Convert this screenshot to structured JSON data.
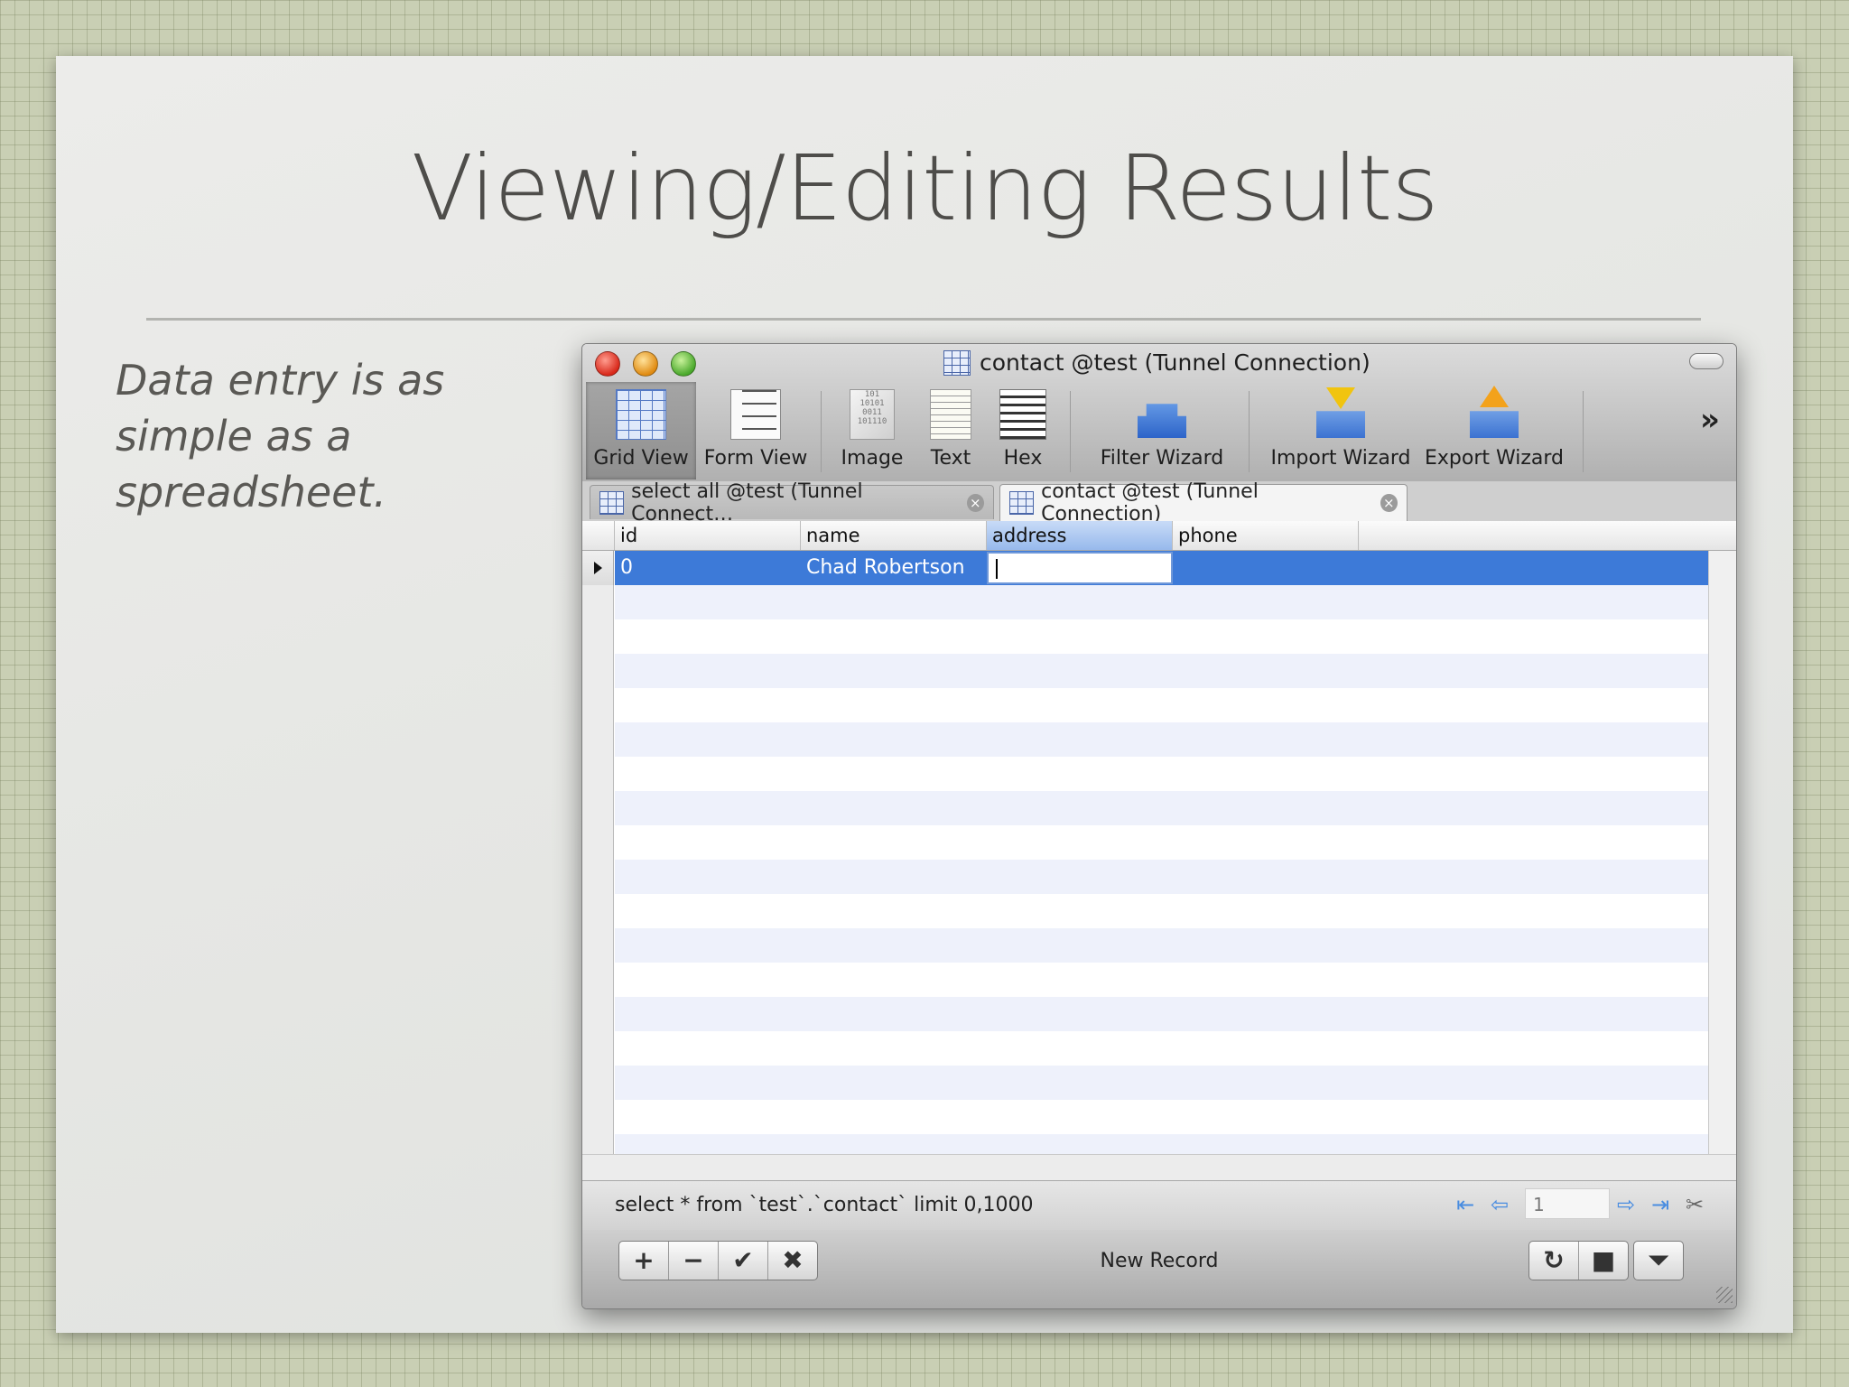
{
  "slide": {
    "title": "Viewing/Editing Results",
    "bullet": "Data entry is as simple as a spreadsheet."
  },
  "window": {
    "title": "contact @test (Tunnel Connection)",
    "title_icon": "table-icon"
  },
  "toolbar": {
    "grid_view": "Grid View",
    "form_view": "Form View",
    "image": "Image",
    "text": "Text",
    "hex": "Hex",
    "filter_wizard": "Filter Wizard",
    "import_wizard": "Import Wizard",
    "export_wizard": "Export Wizard",
    "overflow": "»"
  },
  "tabs": [
    {
      "label": "select all @test (Tunnel Connect…",
      "active": false
    },
    {
      "label": "contact @test (Tunnel Connection)",
      "active": true
    }
  ],
  "grid": {
    "columns": [
      "id",
      "name",
      "address",
      "phone"
    ],
    "selected_column": "address",
    "rows": [
      {
        "id": "0",
        "name": "Chad Robertson",
        "address": "",
        "phone": ""
      }
    ]
  },
  "sqlbar": {
    "query": "select * from `test`.`contact`  limit 0,1000",
    "page": "1"
  },
  "bottombar": {
    "add": "+",
    "remove": "−",
    "apply": "✔",
    "discard": "✖",
    "status": "New Record",
    "refresh": "↻",
    "stop": "■",
    "menu": "⏷"
  },
  "colors": {
    "selected_row": "#3d7ad8",
    "selected_header": "#97b9ec"
  }
}
